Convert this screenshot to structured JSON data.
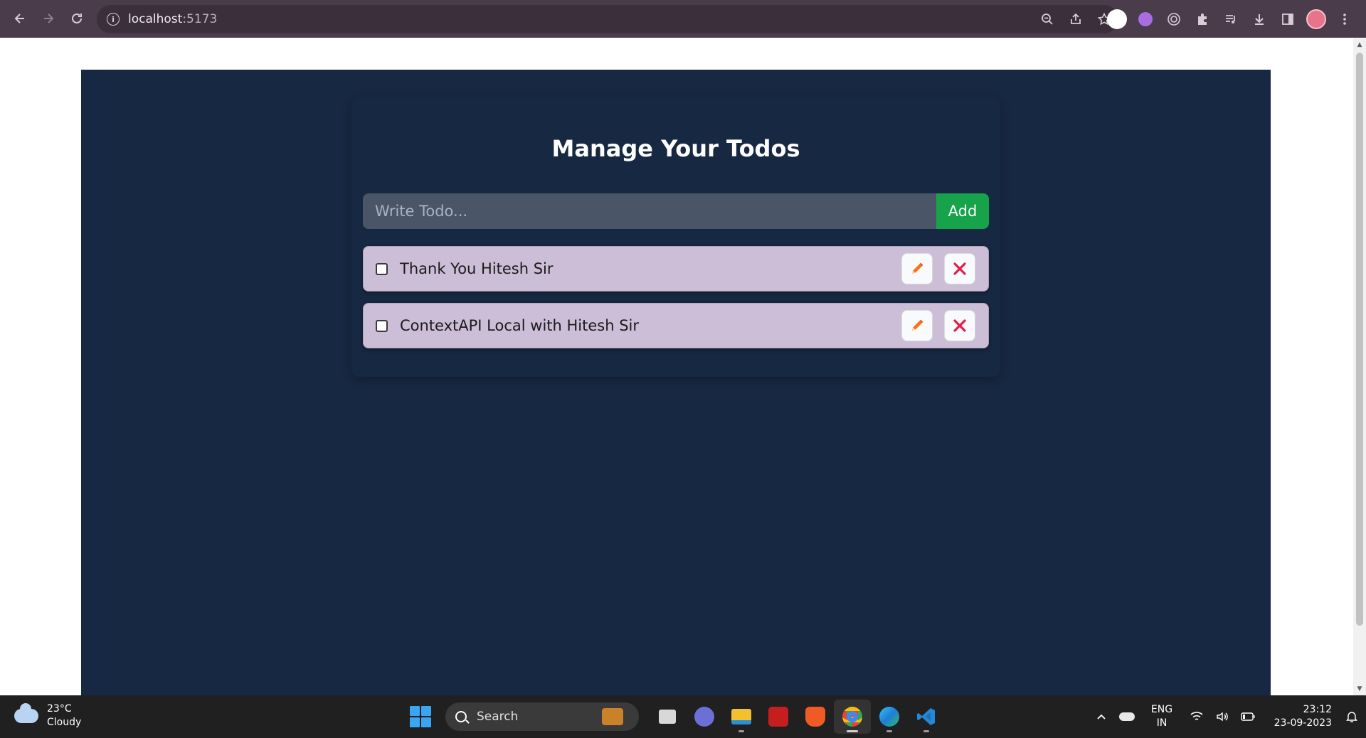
{
  "browser": {
    "url_host": "localhost",
    "url_port": ":5173"
  },
  "page": {
    "title": "Manage Your Todos",
    "input_placeholder": "Write Todo...",
    "add_label": "Add",
    "todos": [
      {
        "text": "Thank You Hitesh Sir",
        "completed": false
      },
      {
        "text": "ContextAPI Local with Hitesh Sir",
        "completed": false
      }
    ],
    "edit_icon": "pencil-icon",
    "delete_icon": "close-icon"
  },
  "taskbar": {
    "weather_temp": "23°C",
    "weather_desc": "Cloudy",
    "search_label": "Search",
    "lang_line1": "ENG",
    "lang_line2": "IN",
    "time": "23:12",
    "date": "23-09-2023"
  },
  "colors": {
    "app_background": "#172842",
    "todo_background": "#ccbed7",
    "add_button": "#16a34a",
    "input_background": "#4a5568",
    "delete_icon": "#e11d48",
    "edit_icon": "#f97316"
  }
}
